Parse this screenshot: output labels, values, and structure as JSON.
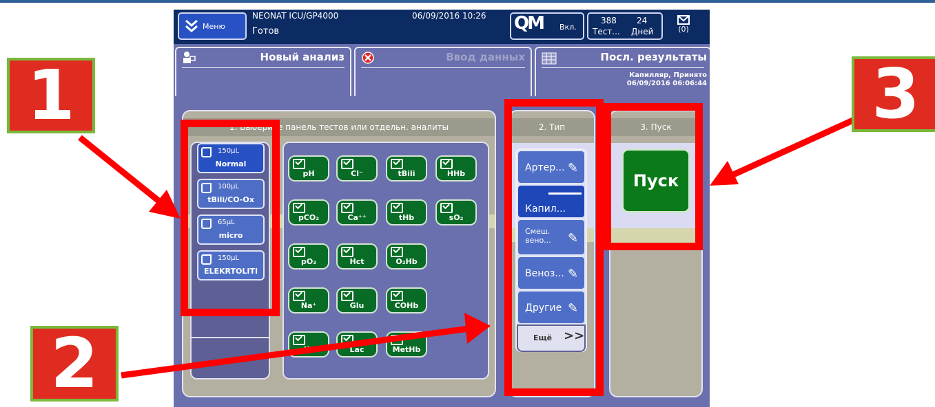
{
  "header": {
    "menu_label": "Меню",
    "device_name": "NEONAT ICU/GP4000",
    "status": "Готов",
    "datetime": "06/09/2016 10:26",
    "qc_logo": "QM",
    "qc_state": "Вкл.",
    "tests_count": "388",
    "tests_label": "Тест...",
    "days_count": "24",
    "days_label": "Дней",
    "messages": "(0)"
  },
  "tabs": [
    {
      "label": "Новый анализ"
    },
    {
      "label": "Ввод данных"
    },
    {
      "label": "Посл. результаты",
      "sub1": "Капилляр, Принято",
      "sub2": "06/09/2016 06:06:44"
    }
  ],
  "panels_pane": {
    "title": "1. Выберите панель тестов или отдельн. аналиты",
    "panels": [
      {
        "volume": "150µL",
        "name": "Normal",
        "selected": true
      },
      {
        "volume": "100µL",
        "name": "tBili/CO-Ox",
        "selected": false
      },
      {
        "volume": "65µL",
        "name": "micro",
        "selected": false
      },
      {
        "volume": "150µL",
        "name": "ELEKRTOLITI",
        "selected": false
      }
    ],
    "analytes": [
      {
        "label": "pH"
      },
      {
        "label": "Cl⁻"
      },
      {
        "label": "tBili"
      },
      {
        "label": "HHb"
      },
      {
        "label": "pCO₂"
      },
      {
        "label": "Ca⁺⁺"
      },
      {
        "label": "tHb"
      },
      {
        "label": "sO₂"
      },
      {
        "label": "pO₂"
      },
      {
        "label": "Hct"
      },
      {
        "label": "O₂Hb"
      },
      {
        "label": "Na⁺"
      },
      {
        "label": "Glu"
      },
      {
        "label": "COHb"
      },
      {
        "label": "K⁺"
      },
      {
        "label": "Lac"
      },
      {
        "label": "MetHb"
      }
    ]
  },
  "type_pane": {
    "title": "2. Тип",
    "types": [
      {
        "label": "Артер..."
      },
      {
        "label": "Капил..."
      },
      {
        "label": "Смеш. вено..."
      },
      {
        "label": "Веноз..."
      },
      {
        "label": "Другие"
      }
    ],
    "more_label": "Ещё",
    "more_icon": ">>"
  },
  "start_pane": {
    "title": "3. Пуск",
    "start_label": "Пуск"
  },
  "annotations": {
    "badge1": "1",
    "badge2": "2",
    "badge3": "3",
    "color": "#ff0000"
  }
}
